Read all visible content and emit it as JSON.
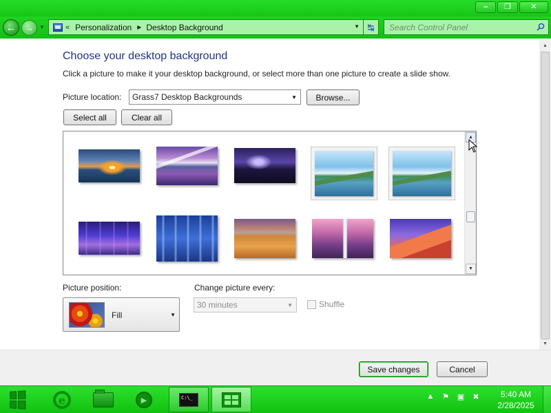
{
  "window": {
    "buttons": {
      "minimize": "‒",
      "maximize": "❐",
      "close": "✕"
    }
  },
  "navbar": {
    "breadcrumb_prefix": "«",
    "breadcrumbs": [
      "Personalization",
      "Desktop Background"
    ],
    "search_placeholder": "Search Control Panel"
  },
  "main": {
    "heading": "Choose your desktop background",
    "description": "Click a picture to make it your desktop background, or select more than one picture to create a slide show.",
    "location_label": "Picture location:",
    "location_value": "Grass7 Desktop Backgrounds",
    "browse_label": "Browse...",
    "select_all_label": "Select all",
    "clear_all_label": "Clear all",
    "thumbnails": [
      {
        "name": "sunset-rocks",
        "selected": false
      },
      {
        "name": "mountain-lake-pink",
        "selected": false
      },
      {
        "name": "night-ice",
        "selected": false
      },
      {
        "name": "green-hills-lake",
        "selected": true
      },
      {
        "name": "green-hills-lake-2",
        "selected": true
      },
      {
        "name": "aurora-purple",
        "selected": false
      },
      {
        "name": "blue-light-rays",
        "selected": false
      },
      {
        "name": "golden-field",
        "selected": false
      },
      {
        "name": "waterfall-sunset",
        "selected": false
      },
      {
        "name": "red-dunes",
        "selected": false
      }
    ],
    "position_label": "Picture position:",
    "position_value": "Fill",
    "change_label": "Change picture every:",
    "change_value": "30 minutes",
    "shuffle_label": "Shuffle"
  },
  "footer": {
    "save_label": "Save changes",
    "cancel_label": "Cancel"
  },
  "taskbar": {
    "cmd_text": "C:\\_",
    "clock_time": "5:40 AM",
    "clock_date": "2/28/2025"
  },
  "colors": {
    "accent": "#1ccf1c",
    "address_bg": "#a9f3a9",
    "heading": "#1e3287"
  }
}
